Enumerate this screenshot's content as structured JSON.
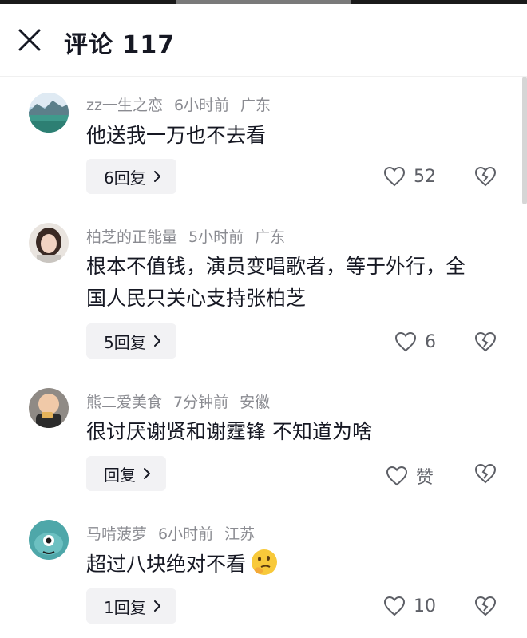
{
  "header": {
    "title": "评论 117"
  },
  "comments": [
    {
      "user": "zz一生之恋",
      "time": "6小时前",
      "location": "广东",
      "text": "他送我一万也不去看",
      "reply_label": "6回复",
      "likes": "52",
      "avatar": "landscape-avatar"
    },
    {
      "user": "柏芝的正能量",
      "time": "5小时前",
      "location": "广东",
      "text": "根本不值钱，演员变唱歌者，等于外行，全国人民只关心支持张柏芝",
      "reply_label": "5回复",
      "likes": "6",
      "avatar": "woman-photo-avatar"
    },
    {
      "user": "熊二爱美食",
      "time": "7分钟前",
      "location": "安徽",
      "text": "很讨厌谢贤和谢霆锋 不知道为啥",
      "reply_label": "回复",
      "likes": "赞",
      "avatar": "man-eating-avatar"
    },
    {
      "user": "马啃菠萝",
      "time": "6小时前",
      "location": "江苏",
      "text": "超过八块绝对不看",
      "reply_label": "1回复",
      "likes": "10",
      "avatar": "cartoon-monster-avatar",
      "emoji": "thinking-face-emoji"
    }
  ],
  "colors": {
    "meta": "#8a8b91",
    "text": "#161823",
    "reply_bg": "#f2f2f4",
    "icon": "#5d5f66"
  }
}
